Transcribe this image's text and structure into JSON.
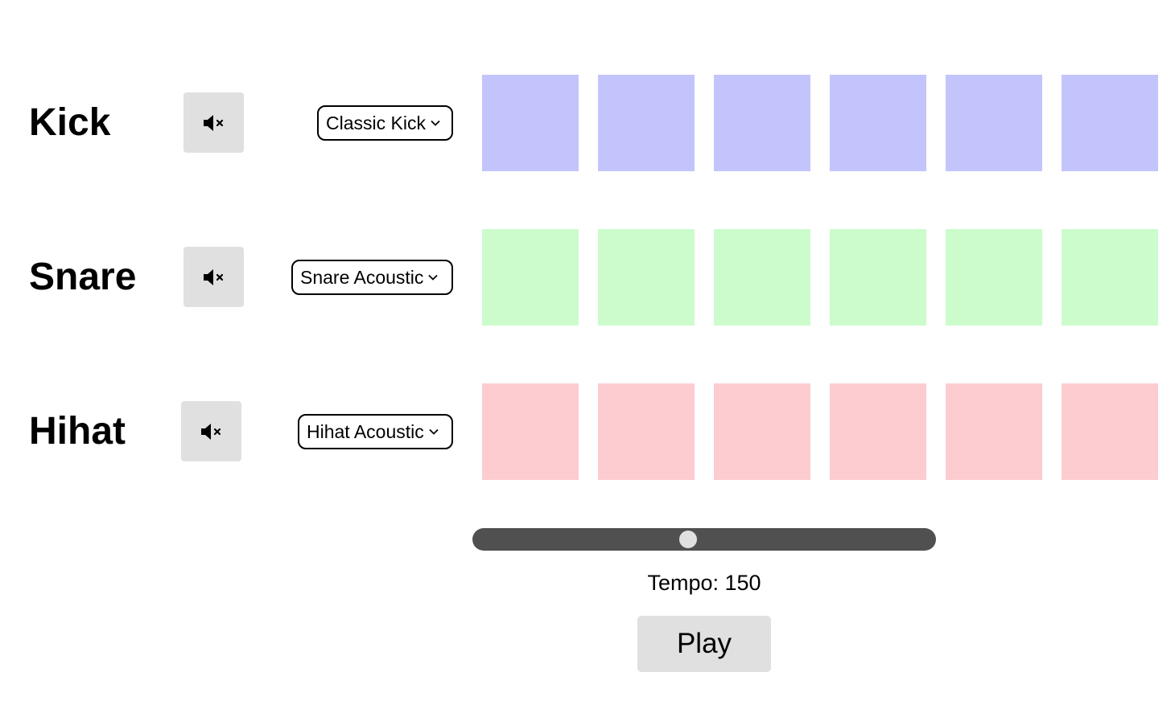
{
  "tracks": [
    {
      "name": "Kick",
      "sample": "Classic Kick",
      "mute_icon": "speaker-muted-icon",
      "pad_color": "#c4c4fc",
      "steps": [
        false,
        false,
        false,
        false,
        false,
        false
      ]
    },
    {
      "name": "Snare",
      "sample": "Snare Acoustic",
      "mute_icon": "speaker-muted-icon",
      "pad_color": "#ccfccc",
      "steps": [
        false,
        false,
        false,
        false,
        false,
        false
      ]
    },
    {
      "name": "Hihat",
      "sample": "Hihat Acoustic",
      "mute_icon": "speaker-muted-icon",
      "pad_color": "#fcccd0",
      "steps": [
        false,
        false,
        false,
        false,
        false,
        false
      ]
    }
  ],
  "tempo": {
    "label": "Tempo: 150",
    "value": 150,
    "slider_position": 0.465
  },
  "play_button": {
    "label": "Play"
  },
  "colors": {
    "slider_track": "#505050",
    "slider_thumb": "#e0e0e0",
    "button_bg": "#e0e0e0"
  }
}
